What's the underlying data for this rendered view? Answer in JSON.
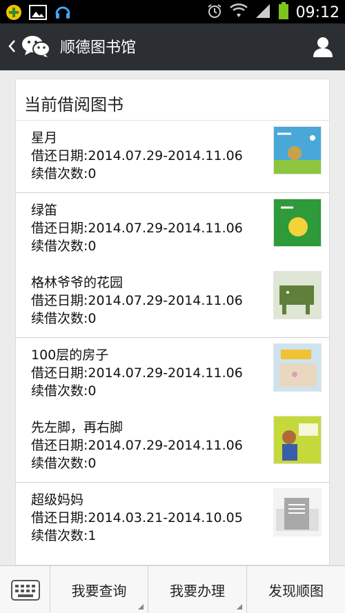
{
  "status_bar": {
    "time": "09:12",
    "icons": [
      "app-notification-icon",
      "image-notification-icon",
      "headset-notification-icon",
      "alarm-icon",
      "wifi-icon",
      "signal-icon",
      "battery-icon"
    ]
  },
  "header": {
    "title": "顺德图书馆",
    "back_icon": "chevron-left-icon",
    "app_icon": "wechat-logo-icon",
    "profile_icon": "user-profile-icon"
  },
  "card": {
    "title": "当前借阅图书",
    "books": [
      {
        "name": "星月",
        "dates": "借还日期:2014.07.29-2014.11.06",
        "renewals": "续借次数:0"
      },
      {
        "name": "绿笛",
        "dates": "借还日期:2014.07.29-2014.11.06",
        "renewals": "续借次数:0"
      },
      {
        "name": "格林爷爷的花园",
        "dates": "借还日期:2014.07.29-2014.11.06",
        "renewals": "续借次数:0"
      },
      {
        "name": "100层的房子",
        "dates": "借还日期:2014.07.29-2014.11.06",
        "renewals": "续借次数:0"
      },
      {
        "name": "先左脚，再右脚",
        "dates": "借还日期:2014.07.29-2014.11.06",
        "renewals": "续借次数:0"
      },
      {
        "name": "超级妈妈",
        "dates": "借还日期:2014.03.21-2014.10.05",
        "renewals": "续借次数:1"
      }
    ]
  },
  "bottom_menu": {
    "keyboard_icon": "keyboard-icon",
    "items": [
      "我要查询",
      "我要办理",
      "发现顺图"
    ]
  },
  "colors": {
    "status_bar_bg": "#000000",
    "title_bar_bg": "#2b2f33",
    "page_bg": "#ececec",
    "card_bg": "#ffffff",
    "battery": "#7dc41f"
  }
}
